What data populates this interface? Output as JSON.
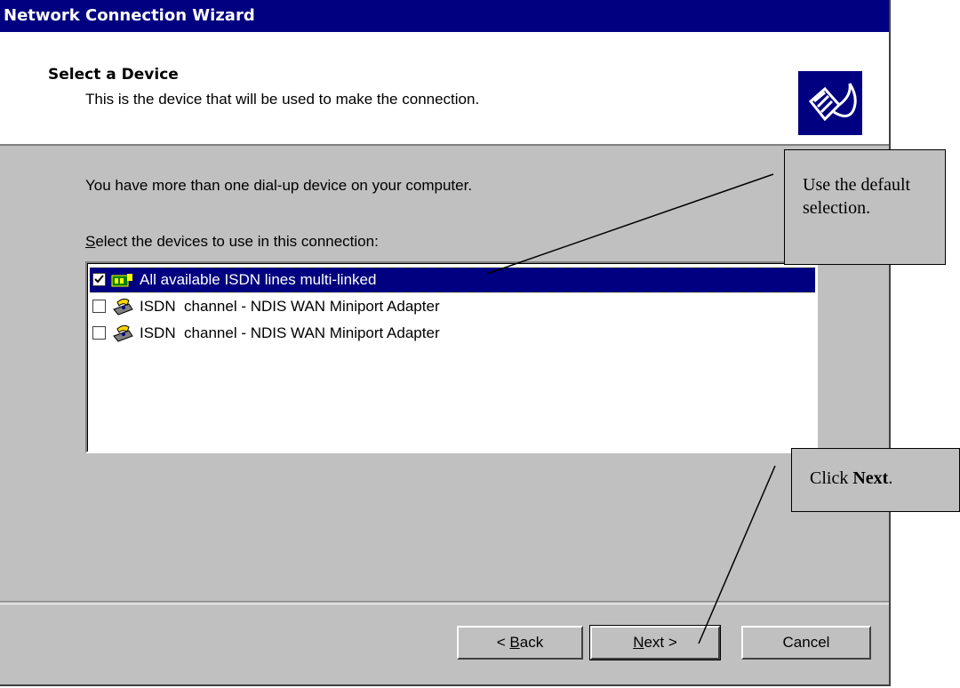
{
  "window": {
    "title": "Network Connection Wizard"
  },
  "header": {
    "title": "Select a Device",
    "subtitle": "This is the device that will be used to make the connection.",
    "icon": "network-cable-icon"
  },
  "body": {
    "intro": "You have more than one dial-up device on your computer.",
    "select_label_accel": "S",
    "select_label_rest": "elect the devices to use in this connection:"
  },
  "devices": [
    {
      "label": "All available ISDN lines multi-linked",
      "checked": true,
      "selected": true,
      "icon": "isdn-multilink-icon"
    },
    {
      "label": "ISDN  channel - NDIS WAN Miniport Adapter",
      "checked": false,
      "selected": false,
      "icon": "modem-phone-icon"
    },
    {
      "label": "ISDN  channel - NDIS WAN Miniport Adapter",
      "checked": false,
      "selected": false,
      "icon": "modem-phone-icon"
    }
  ],
  "buttons": {
    "back_prefix": "< ",
    "back_accel": "B",
    "back_rest": "ack",
    "next_accel": "N",
    "next_rest": "ext >",
    "cancel": "Cancel"
  },
  "callouts": {
    "default_selection": "Use the default selection.",
    "click_prefix": "Click ",
    "click_bold": "Next",
    "click_suffix": "."
  },
  "colors": {
    "title_bar": "#000080",
    "dialog_face": "#c0c0c0",
    "selection": "#000080"
  }
}
